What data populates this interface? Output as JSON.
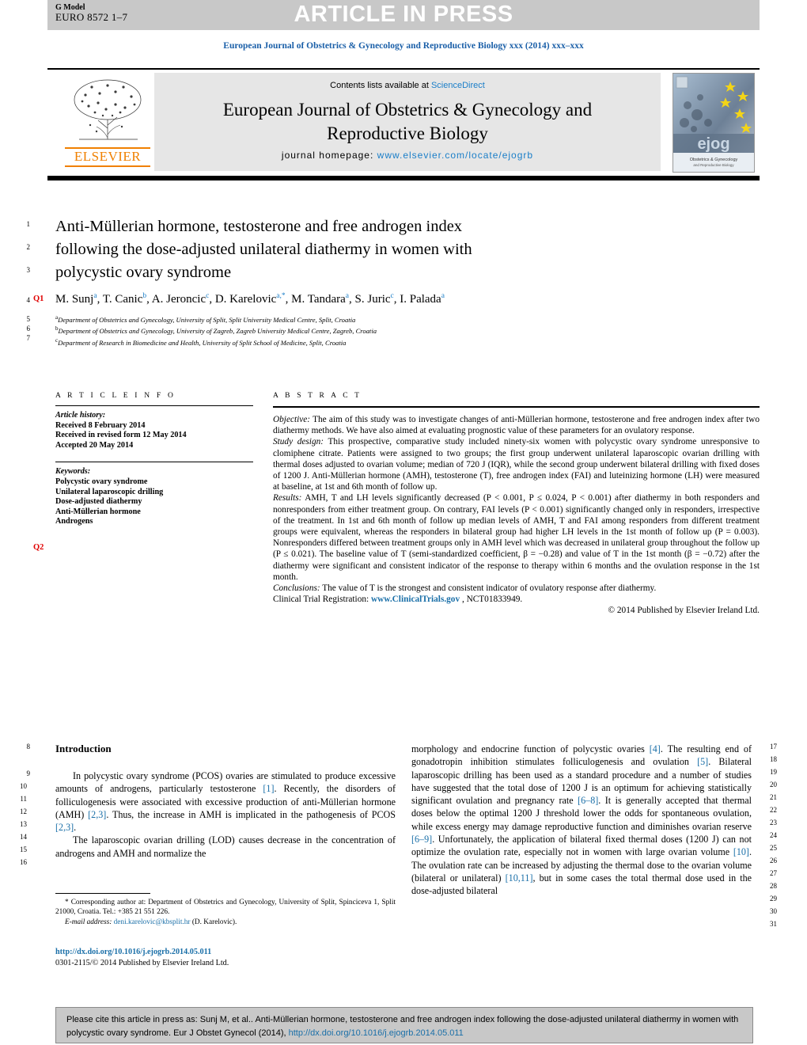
{
  "header": {
    "g_model_label": "G Model",
    "g_model_id": "EURO 8572 1–7",
    "article_in_press": "ARTICLE IN PRESS",
    "journal_running_head": "European Journal of Obstetrics & Gynecology and Reproductive Biology xxx (2014) xxx–xxx"
  },
  "masthead": {
    "contents_prefix": "Contents lists available at",
    "contents_link": "ScienceDirect",
    "journal_title_line1": "European Journal of Obstetrics & Gynecology and",
    "journal_title_line2": "Reproductive Biology",
    "homepage_label": "journal homepage:",
    "homepage_url": "www.elsevier.com/locate/ejogrb",
    "publisher_logo_text": "ELSEVIER",
    "cover_logo_text": "ejog",
    "cover_caption": "Obstetrics & Gynecology",
    "cover_caption2": "and Reproductive Biology"
  },
  "article": {
    "title_line1": "Anti-Müllerian hormone, testosterone and free androgen index",
    "title_line2": "following the dose-adjusted unilateral diathermy in women with",
    "title_line3": "polycystic ovary syndrome",
    "authors": [
      {
        "name": "M. Sunj",
        "sup": "a"
      },
      {
        "name": "T. Canic",
        "sup": "b"
      },
      {
        "name": "A. Jeroncic",
        "sup": "c"
      },
      {
        "name": "D. Karelovic",
        "sup": "a,*"
      },
      {
        "name": "M. Tandara",
        "sup": "a"
      },
      {
        "name": "S. Juric",
        "sup": "c"
      },
      {
        "name": "I. Palada",
        "sup": "a"
      }
    ],
    "affiliations": [
      {
        "mark": "a",
        "text": "Department of Obstetrics and Gynecology, University of Split, Split University Medical Centre, Split, Croatia"
      },
      {
        "mark": "b",
        "text": "Department of Obstetrics and Gynecology, University of Zagreb, Zagreb University Medical Centre, Zagreb, Croatia"
      },
      {
        "mark": "c",
        "text": "Department of Research in Biomedicine and Health, University of Split School of Medicine, Split, Croatia"
      }
    ]
  },
  "query_marks": {
    "q1": "Q1",
    "q2": "Q2"
  },
  "line_numbers": {
    "left_top": [
      "1",
      "2",
      "3",
      "4",
      "5",
      "6",
      "7"
    ],
    "left_body": [
      "8",
      "9",
      "10",
      "11",
      "12",
      "13",
      "14",
      "15",
      "16"
    ],
    "right_body": [
      "17",
      "18",
      "19",
      "20",
      "21",
      "22",
      "23",
      "24",
      "25",
      "26",
      "27",
      "28",
      "29",
      "30",
      "31"
    ]
  },
  "article_info": {
    "heading": "A R T I C L E   I N F O",
    "history_label": "Article history:",
    "history": [
      "Received 8 February 2014",
      "Received in revised form 12 May 2014",
      "Accepted 20 May 2014"
    ],
    "keywords_label": "Keywords:",
    "keywords": [
      "Polycystic ovary syndrome",
      "Unilateral laparoscopic drilling",
      "Dose-adjusted diathermy",
      "Anti-Müllerian hormone",
      "Androgens"
    ]
  },
  "abstract": {
    "heading": "A B S T R A C T",
    "objective_label": "Objective:",
    "objective_text": " The aim of this study was to investigate changes of anti-Müllerian hormone, testosterone and free androgen index after two diathermy methods. We have also aimed at evaluating prognostic value of these parameters for an ovulatory response.",
    "study_design_label": "Study design:",
    "study_design_text": " This prospective, comparative study included ninety-six women with polycystic ovary syndrome unresponsive to clomiphene citrate. Patients were assigned to two groups; the first group underwent unilateral laparoscopic ovarian drilling with thermal doses adjusted to ovarian volume; median of 720 J (IQR), while the second group underwent bilateral drilling with fixed doses of 1200 J. Anti-Müllerian hormone (AMH), testosterone (T), free androgen index (FAI) and luteinizing hormone (LH) were measured at baseline, at 1st and 6th month of follow up.",
    "results_label": "Results:",
    "results_text": " AMH, T and LH levels significantly decreased (P < 0.001, P ≤ 0.024, P < 0.001) after diathermy in both responders and nonresponders from either treatment group. On contrary, FAI levels (P < 0.001) significantly changed only in responders, irrespective of the treatment. In 1st and 6th month of follow up median levels of AMH, T and FAI among responders from different treatment groups were equivalent, whereas the responders in bilateral group had higher LH levels in the 1st month of follow up (P = 0.003). Nonresponders differed between treatment groups only in AMH level which was decreased in unilateral group throughout the follow up (P ≤ 0.021). The baseline value of T (semi-standardized coefficient, β = −0.28) and value of T in the 1st month (β = −0.72) after the diathermy were significant and consistent indicator of the response to therapy within 6 months and the ovulation response in the 1st month.",
    "conclusions_label": "Conclusions:",
    "conclusions_text": " The value of T is the strongest and consistent indicator of ovulatory response after diathermy.",
    "trial_registration_label": "Clinical Trial Registration:",
    "trial_registration_link": "www.ClinicalTrials.gov",
    "trial_registration_id": ", NCT01833949.",
    "copyright": "© 2014 Published by Elsevier Ireland Ltd."
  },
  "introduction": {
    "heading": "Introduction",
    "left_p1": "In polycystic ovary syndrome (PCOS) ovaries are stimulated to produce excessive amounts of androgens, particularly testosterone ",
    "left_p1_ref1": "[1]",
    "left_p1_b": ". Recently, the disorders of folliculogenesis were associated with excessive production of anti-Müllerian hormone (AMH) ",
    "left_p1_ref2": "[2,3]",
    "left_p1_c": ". Thus, the increase in AMH is implicated in the pathogenesis of PCOS ",
    "left_p1_ref3": "[2,3]",
    "left_p1_d": ".",
    "left_p2": "The laparoscopic ovarian drilling (LOD) causes decrease in the concentration of androgens and AMH and normalize the",
    "right_a": "morphology and endocrine function of polycystic ovaries ",
    "right_ref4": "[4]",
    "right_b": ". The resulting end of gonadotropin inhibition stimulates folliculogenesis and ovulation ",
    "right_ref5": "[5]",
    "right_c": ". Bilateral laparoscopic drilling has been used as a standard procedure and a number of studies have suggested that the total dose of 1200 J is an optimum for achieving statistically significant ovulation and pregnancy rate ",
    "right_ref68": "[6–8]",
    "right_d": ". It is generally accepted that thermal doses below the optimal 1200 J threshold lower the odds for spontaneous ovulation, while excess energy may damage reproductive function and diminishes ovarian reserve ",
    "right_ref69": "[6–9]",
    "right_e": ". Unfortunately, the application of bilateral fixed thermal doses (1200 J) can not optimize the ovulation rate, especially not in women with large ovarian volume ",
    "right_ref10": "[10]",
    "right_f": ". The ovulation rate can be increased by adjusting the thermal dose to the ovarian volume (bilateral or unilateral) ",
    "right_ref1011": "[10,11]",
    "right_g": ", but in some cases the total thermal dose used in the dose-adjusted bilateral"
  },
  "footnotes": {
    "star": "*",
    "corresponding": " Corresponding author at: Department of Obstetrics and Gynecology, University of Split, Spinciceva 1, Split 21000, Croatia. Tel.: +385 21 551 226.",
    "email_label": "E-mail address:",
    "email": "deni.karelovic@kbsplit.hr",
    "email_owner": " (D. Karelovic).",
    "doi_url": "http://dx.doi.org/10.1016/j.ejogrb.2014.05.011",
    "issn_line": "0301-2115/© 2014 Published by Elsevier Ireland Ltd."
  },
  "citation_footer": {
    "text_a": "Please cite this article in press as: Sunj M, et al.. Anti-Müllerian hormone, testosterone and free androgen index following the dose-adjusted unilateral diathermy in women with polycystic ovary syndrome. Eur J Obstet Gynecol (2014), ",
    "doi": "http://dx.doi.org/10.1016/j.ejogrb.2014.05.011"
  },
  "colors": {
    "link_blue": "#1a7ec8",
    "ref_blue": "#1a6fa8",
    "query_red": "#e00000",
    "elsevier_orange": "#f08000",
    "band_gray": "#c8c8c8"
  }
}
